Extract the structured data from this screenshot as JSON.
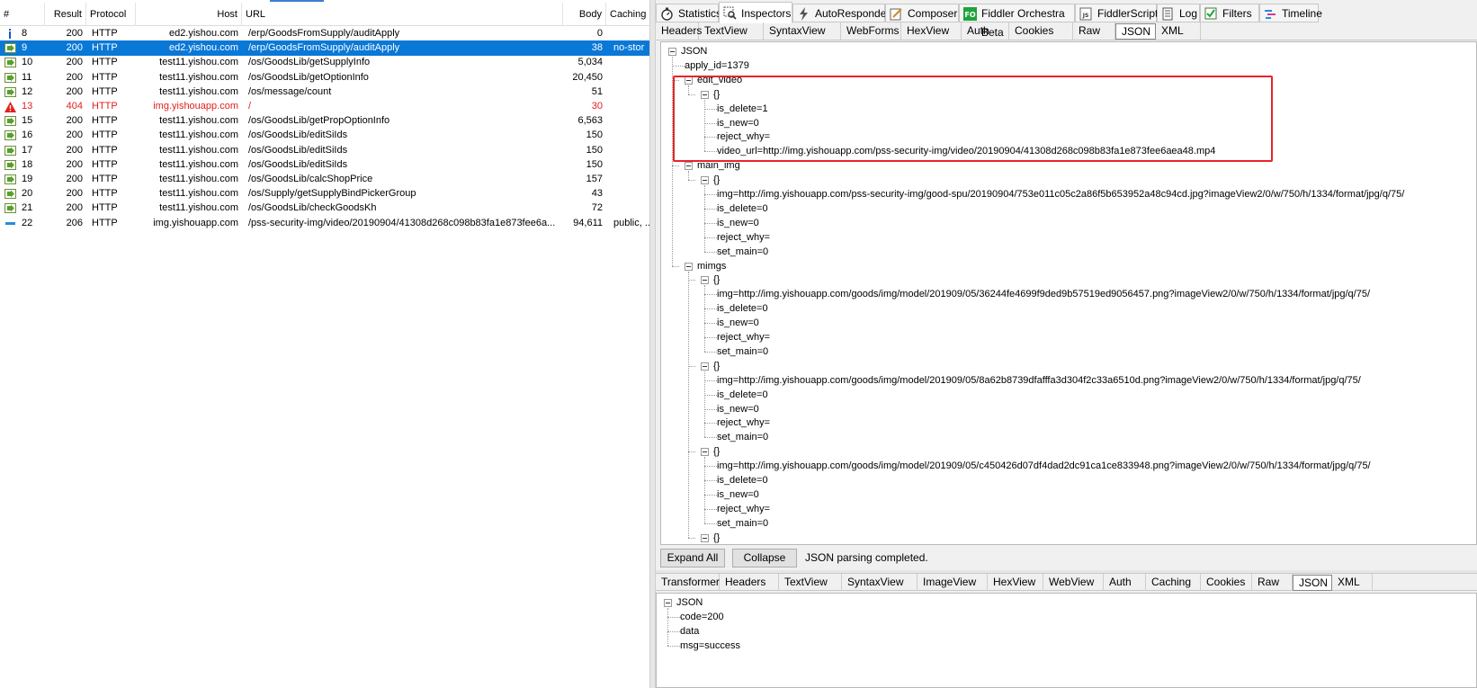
{
  "sessions": {
    "columns": {
      "num": "#",
      "result": "Result",
      "protocol": "Protocol",
      "host": "Host",
      "url": "URL",
      "body": "Body",
      "caching": "Caching"
    },
    "rows": [
      {
        "num": "8",
        "result": "200",
        "protocol": "HTTP",
        "host": "ed2.yishou.com",
        "url": "/erp/GoodsFromSupply/auditApply",
        "body": "0",
        "caching": "",
        "icon": "info-icon"
      },
      {
        "num": "9",
        "result": "200",
        "protocol": "HTTP",
        "host": "ed2.yishou.com",
        "url": "/erp/GoodsFromSupply/auditApply",
        "body": "38",
        "caching": "no-stor",
        "icon": "arrow-right-icon"
      },
      {
        "num": "10",
        "result": "200",
        "protocol": "HTTP",
        "host": "test11.yishou.com",
        "url": "/os/GoodsLib/getSupplyInfo",
        "body": "5,034",
        "caching": "",
        "icon": "arrow-right-icon"
      },
      {
        "num": "11",
        "result": "200",
        "protocol": "HTTP",
        "host": "test11.yishou.com",
        "url": "/os/GoodsLib/getOptionInfo",
        "body": "20,450",
        "caching": "",
        "icon": "arrow-right-icon"
      },
      {
        "num": "12",
        "result": "200",
        "protocol": "HTTP",
        "host": "test11.yishou.com",
        "url": "/os/message/count",
        "body": "51",
        "caching": "",
        "icon": "arrow-right-icon"
      },
      {
        "num": "13",
        "result": "404",
        "protocol": "HTTP",
        "host": "img.yishouapp.com",
        "url": "/",
        "body": "30",
        "caching": "",
        "icon": "warning-icon"
      },
      {
        "num": "15",
        "result": "200",
        "protocol": "HTTP",
        "host": "test11.yishou.com",
        "url": "/os/GoodsLib/getPropOptionInfo",
        "body": "6,563",
        "caching": "",
        "icon": "arrow-right-icon"
      },
      {
        "num": "16",
        "result": "200",
        "protocol": "HTTP",
        "host": "test11.yishou.com",
        "url": "/os/GoodsLib/editSiIds",
        "body": "150",
        "caching": "",
        "icon": "arrow-right-icon"
      },
      {
        "num": "17",
        "result": "200",
        "protocol": "HTTP",
        "host": "test11.yishou.com",
        "url": "/os/GoodsLib/editSiIds",
        "body": "150",
        "caching": "",
        "icon": "arrow-right-icon"
      },
      {
        "num": "18",
        "result": "200",
        "protocol": "HTTP",
        "host": "test11.yishou.com",
        "url": "/os/GoodsLib/editSiIds",
        "body": "150",
        "caching": "",
        "icon": "arrow-right-icon"
      },
      {
        "num": "19",
        "result": "200",
        "protocol": "HTTP",
        "host": "test11.yishou.com",
        "url": "/os/GoodsLib/calcShopPrice",
        "body": "157",
        "caching": "",
        "icon": "arrow-right-icon"
      },
      {
        "num": "20",
        "result": "200",
        "protocol": "HTTP",
        "host": "test11.yishou.com",
        "url": "/os/Supply/getSupplyBindPickerGroup",
        "body": "43",
        "caching": "",
        "icon": "arrow-right-icon"
      },
      {
        "num": "21",
        "result": "200",
        "protocol": "HTTP",
        "host": "test11.yishou.com",
        "url": "/os/GoodsLib/checkGoodsKh",
        "body": "72",
        "caching": "",
        "icon": "arrow-right-icon"
      },
      {
        "num": "22",
        "result": "206",
        "protocol": "HTTP",
        "host": "img.yishouapp.com",
        "url": "/pss-security-img/video/20190904/41308d268c098b83fa1e873fee6a...",
        "body": "94,611",
        "caching": "public, ...",
        "icon": "stream-icon"
      }
    ],
    "selected_index": 1,
    "error_index": 5
  },
  "main_tabs": [
    {
      "label": "Statistics",
      "icon": "stopwatch-icon"
    },
    {
      "label": "Inspectors",
      "icon": "inspect-icon"
    },
    {
      "label": "AutoResponder",
      "icon": "lightning-icon"
    },
    {
      "label": "Composer",
      "icon": "compose-icon"
    },
    {
      "label": "Fiddler Orchestra Beta",
      "icon": "fo-icon",
      "icon_text": "FO"
    },
    {
      "label": "FiddlerScript",
      "icon": "script-icon",
      "icon_text": "JS"
    },
    {
      "label": "Log",
      "icon": "log-icon"
    },
    {
      "label": "Filters",
      "icon": "checkbox-icon"
    },
    {
      "label": "Timeline",
      "icon": "timeline-icon"
    }
  ],
  "request_tabs": [
    "Headers",
    "TextView",
    "SyntaxView",
    "WebForms",
    "HexView",
    "Auth",
    "Cookies",
    "Raw",
    "JSON",
    "XML"
  ],
  "request_tree": [
    {
      "depth": 0,
      "text": "JSON",
      "toggle": true
    },
    {
      "depth": 1,
      "text": "apply_id=1379",
      "toggle": false
    },
    {
      "depth": 1,
      "text": "edit_video",
      "toggle": true
    },
    {
      "depth": 2,
      "text": "{}",
      "toggle": true
    },
    {
      "depth": 3,
      "text": "is_delete=1",
      "toggle": false
    },
    {
      "depth": 3,
      "text": "is_new=0",
      "toggle": false
    },
    {
      "depth": 3,
      "text": "reject_why=",
      "toggle": false
    },
    {
      "depth": 3,
      "text": "video_url=http://img.yishouapp.com/pss-security-img/video/20190904/41308d268c098b83fa1e873fee6aea48.mp4",
      "toggle": false
    },
    {
      "depth": 1,
      "text": "main_img",
      "toggle": true
    },
    {
      "depth": 2,
      "text": "{}",
      "toggle": true
    },
    {
      "depth": 3,
      "text": "img=http://img.yishouapp.com/pss-security-img/good-spu/20190904/753e011c05c2a86f5b653952a48c94cd.jpg?imageView2/0/w/750/h/1334/format/jpg/q/75/",
      "toggle": false
    },
    {
      "depth": 3,
      "text": "is_delete=0",
      "toggle": false
    },
    {
      "depth": 3,
      "text": "is_new=0",
      "toggle": false
    },
    {
      "depth": 3,
      "text": "reject_why=",
      "toggle": false
    },
    {
      "depth": 3,
      "text": "set_main=0",
      "toggle": false
    },
    {
      "depth": 1,
      "text": "mimgs",
      "toggle": true
    },
    {
      "depth": 2,
      "text": "{}",
      "toggle": true
    },
    {
      "depth": 3,
      "text": "img=http://img.yishouapp.com/goods/img/model/201909/05/36244fe4699f9ded9b57519ed9056457.png?imageView2/0/w/750/h/1334/format/jpg/q/75/",
      "toggle": false
    },
    {
      "depth": 3,
      "text": "is_delete=0",
      "toggle": false
    },
    {
      "depth": 3,
      "text": "is_new=0",
      "toggle": false
    },
    {
      "depth": 3,
      "text": "reject_why=",
      "toggle": false
    },
    {
      "depth": 3,
      "text": "set_main=0",
      "toggle": false
    },
    {
      "depth": 2,
      "text": "{}",
      "toggle": true
    },
    {
      "depth": 3,
      "text": "img=http://img.yishouapp.com/goods/img/model/201909/05/8a62b8739dfafffa3d304f2c33a6510d.png?imageView2/0/w/750/h/1334/format/jpg/q/75/",
      "toggle": false
    },
    {
      "depth": 3,
      "text": "is_delete=0",
      "toggle": false
    },
    {
      "depth": 3,
      "text": "is_new=0",
      "toggle": false
    },
    {
      "depth": 3,
      "text": "reject_why=",
      "toggle": false
    },
    {
      "depth": 3,
      "text": "set_main=0",
      "toggle": false
    },
    {
      "depth": 2,
      "text": "{}",
      "toggle": true
    },
    {
      "depth": 3,
      "text": "img=http://img.yishouapp.com/goods/img/model/201909/05/c450426d07df4dad2dc91ca1ce833948.png?imageView2/0/w/750/h/1334/format/jpg/q/75/",
      "toggle": false
    },
    {
      "depth": 3,
      "text": "is_delete=0",
      "toggle": false
    },
    {
      "depth": 3,
      "text": "is_new=0",
      "toggle": false
    },
    {
      "depth": 3,
      "text": "reject_why=",
      "toggle": false
    },
    {
      "depth": 3,
      "text": "set_main=0",
      "toggle": false
    },
    {
      "depth": 2,
      "text": "{}",
      "toggle": true
    }
  ],
  "buttons": {
    "expand_all": "Expand All",
    "collapse": "Collapse",
    "status": "JSON parsing completed."
  },
  "response_tabs": [
    "Transformer",
    "Headers",
    "TextView",
    "SyntaxView",
    "ImageView",
    "HexView",
    "WebView",
    "Auth",
    "Caching",
    "Cookies",
    "Raw",
    "JSON",
    "XML"
  ],
  "response_tree": [
    {
      "depth": 0,
      "text": "JSON",
      "toggle": true
    },
    {
      "depth": 1,
      "text": "code=200",
      "toggle": false
    },
    {
      "depth": 1,
      "text": "data",
      "toggle": false
    },
    {
      "depth": 1,
      "text": "msg=success",
      "toggle": false
    }
  ],
  "colors": {
    "selection": "#0a78d7",
    "error": "#e0201d",
    "highlight_box": "#e8242a",
    "fo_green": "#1fa33a"
  }
}
